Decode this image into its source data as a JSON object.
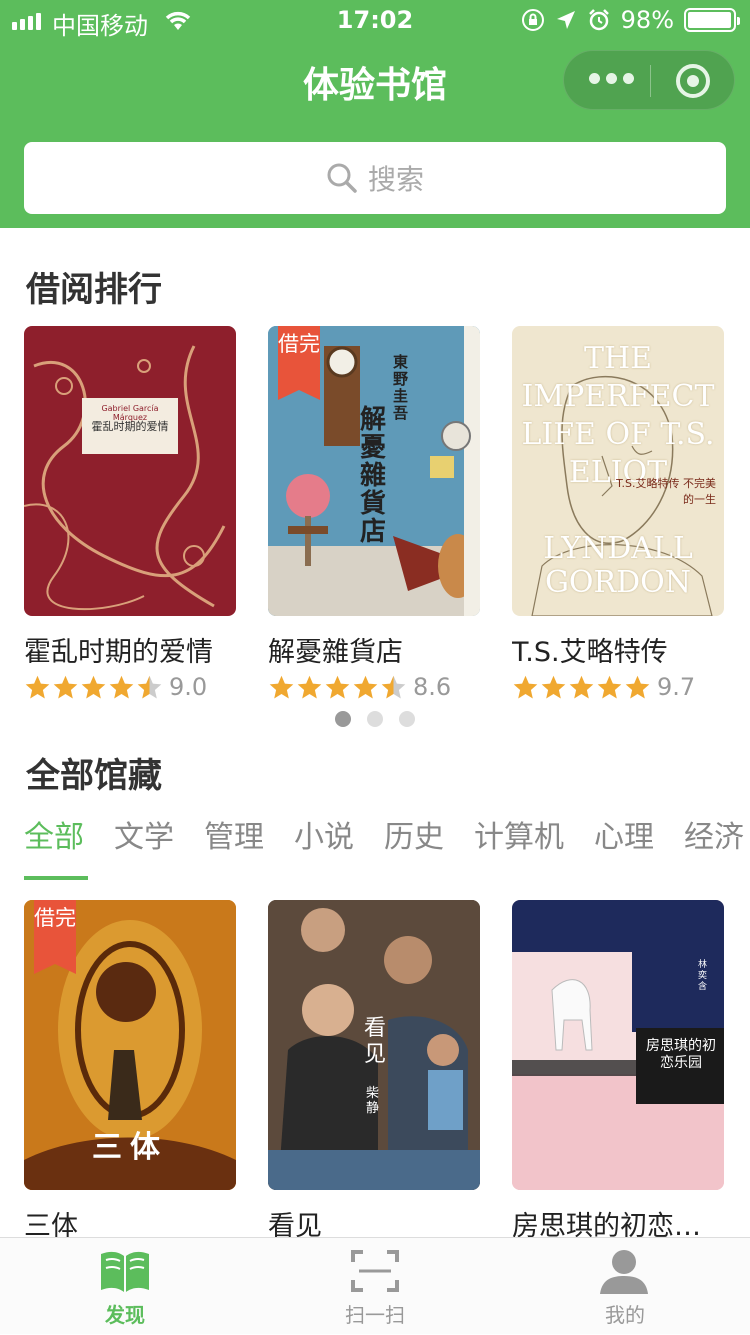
{
  "status": {
    "carrier": "中国移动",
    "time": "17:02",
    "battery": "98%",
    "battery_level": 0.98
  },
  "nav": {
    "title": "体验书馆"
  },
  "search": {
    "placeholder": "搜索"
  },
  "ranking": {
    "title": "借阅排行",
    "books": [
      {
        "title": "霍乱时期的爱情",
        "score": "9.0",
        "stars": 4.5,
        "badge": "",
        "cover_text": "霍乱时期的爱情",
        "author_en": "Gabriel García Márquez"
      },
      {
        "title": "解憂雜貨店",
        "score": "8.6",
        "stars": 4.5,
        "badge": "借完",
        "cover_text": "解憂雜貨店",
        "author": "東野圭吾"
      },
      {
        "title": "T.S.艾略特传",
        "score": "9.7",
        "stars": 5,
        "badge": "",
        "cover_en1": "THE IMPERFECT LIFE OF T.S. ELIOT",
        "cover_en2": "LYNDALL GORDON",
        "cover_cn": "T.S.艾略特传 不完美的一生"
      }
    ]
  },
  "collection": {
    "title": "全部馆藏",
    "tabs": [
      "全部",
      "文学",
      "管理",
      "小说",
      "历史",
      "计算机",
      "心理",
      "经济"
    ],
    "books": [
      {
        "title": "三体",
        "badge": "借完",
        "cover_text": "三体"
      },
      {
        "title": "看见",
        "badge": "",
        "cover_text": "看见",
        "author": "柴静"
      },
      {
        "title": "房思琪的初恋乐园",
        "badge": "",
        "cover_text": "房思琪的初恋乐园",
        "author": "林奕含"
      }
    ]
  },
  "tabbar": {
    "items": [
      {
        "label": "发现",
        "icon": "book-icon"
      },
      {
        "label": "扫一扫",
        "icon": "scan-icon"
      },
      {
        "label": "我的",
        "icon": "user-icon"
      }
    ]
  },
  "colors": {
    "primary": "#5cbd5c",
    "star": "#f0a830",
    "badge": "#e8543a"
  }
}
